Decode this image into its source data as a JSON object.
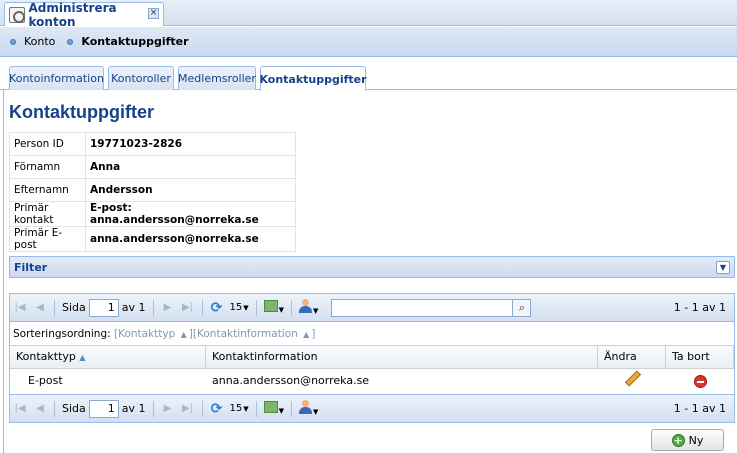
{
  "window": {
    "tab_title": "Administrera konton",
    "close_glyph": "×"
  },
  "breadcrumb": {
    "items": [
      "Konto"
    ],
    "current": "Kontaktuppgifter"
  },
  "tabs": [
    "Kontoinformation",
    "Kontoroller",
    "Medlemsroller",
    "Kontaktuppgifter"
  ],
  "active_tab": "Kontaktuppgifter",
  "page_title": "Kontaktuppgifter",
  "info": [
    {
      "label": "Person ID",
      "value": "19771023-2826"
    },
    {
      "label": "Förnamn",
      "value": "Anna"
    },
    {
      "label": "Efternamn",
      "value": "Andersson"
    },
    {
      "label": "Primär kontakt",
      "value": "E-post: anna.andersson@norreka.se"
    },
    {
      "label": "Primär E-post",
      "value": "anna.andersson@norreka.se"
    }
  ],
  "filter": {
    "label": "Filter"
  },
  "pager": {
    "page_label": "Sida",
    "page_value": "1",
    "of_label": "av 1",
    "page_size": "15",
    "count": "1 - 1 av 1",
    "search_placeholder": ""
  },
  "sorting": {
    "label": "Sorteringsordning:",
    "fields": [
      "Kontakttyp",
      "Kontaktinformation"
    ]
  },
  "columns": [
    "Kontakttyp",
    "Kontaktinformation",
    "Ändra",
    "Ta bort"
  ],
  "rows": [
    {
      "type": "E-post",
      "info": "anna.andersson@norreka.se"
    }
  ],
  "new_button": "Ny",
  "icons": {
    "first": "first-page-icon",
    "prev": "prev-page-icon",
    "next": "next-page-icon",
    "last": "last-page-icon",
    "refresh": "refresh-icon",
    "export": "export-icon",
    "user": "user-icon",
    "search": "search-icon",
    "edit": "pencil-icon",
    "delete": "delete-icon",
    "add": "add-icon"
  },
  "colors": {
    "accent": "#15428b",
    "border": "#99bbe8",
    "delete": "#d8342d",
    "add": "#4cab3c"
  }
}
